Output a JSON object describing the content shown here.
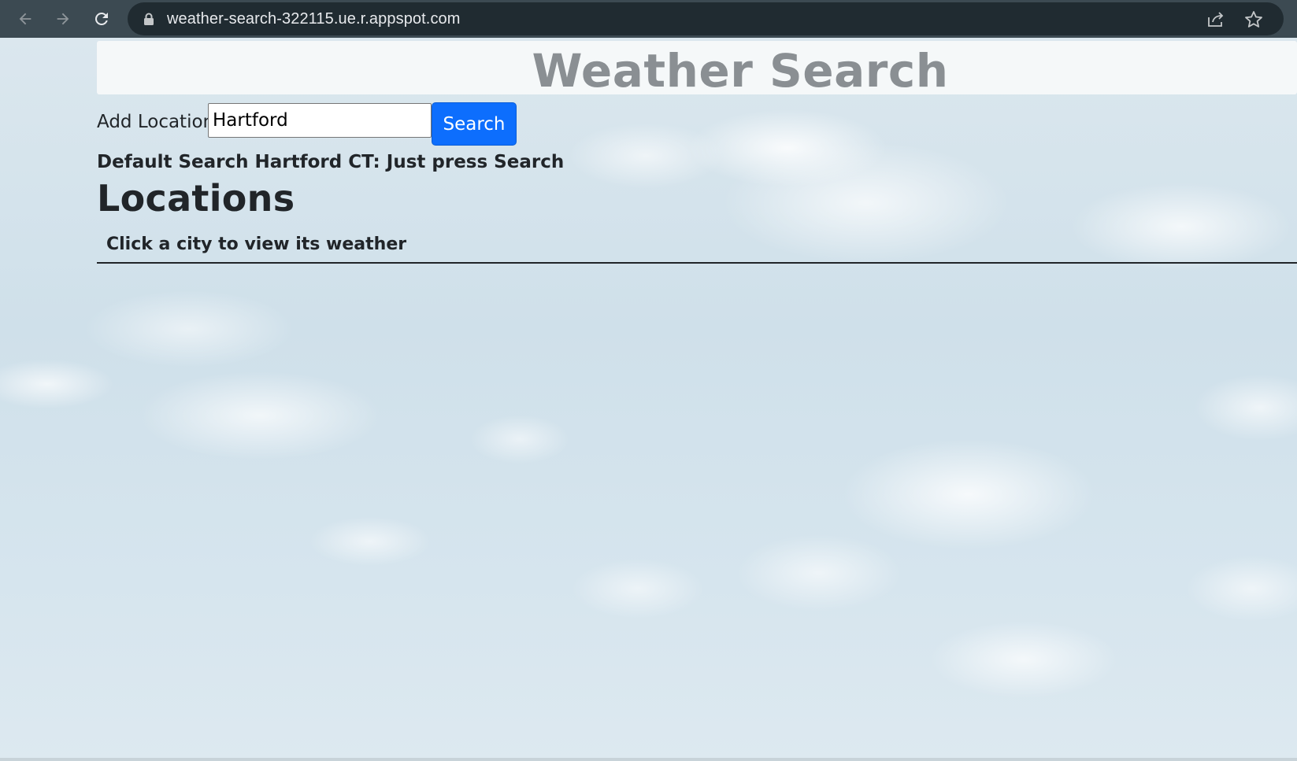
{
  "browser": {
    "url": "weather-search-322115.ue.r.appspot.com",
    "icons": [
      "back-icon",
      "forward-icon",
      "reload-icon",
      "lock-icon",
      "share-icon",
      "bookmark-star-icon"
    ]
  },
  "header": {
    "title": "Weather Search"
  },
  "search": {
    "label": "Add Location",
    "value": "Hartford",
    "button_label": "Search",
    "hint": "Default Search Hartford CT: Just press Search"
  },
  "locations": {
    "heading": "Locations",
    "table_header": "Click a city to view its weather"
  },
  "colors": {
    "browser_bar": "#3c4a52",
    "omnibox": "#202b31",
    "primary_button": "#0d6efd",
    "title_text": "#8a8f93",
    "body_text": "#212529"
  }
}
